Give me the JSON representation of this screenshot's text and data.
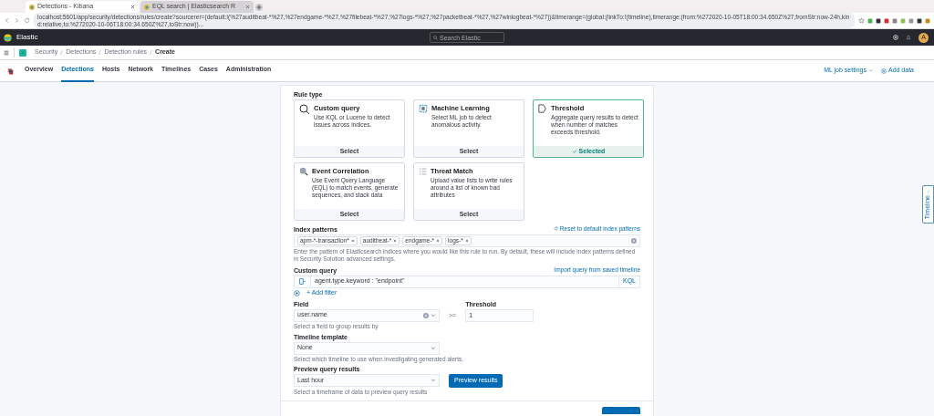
{
  "browser": {
    "tabs": [
      {
        "title": "Detections - Kibana",
        "selected": true
      },
      {
        "title": "EQL search | Elasticsearch R",
        "selected": false
      }
    ],
    "url": "localhost:5601/app/security/detections/rules/create?sourcerer=(default:!(%27auditbeat-*%27,%27endgame-*%27,%27filebeat-*%27,%27logs-*%27,%27packetbeat-*%27,%27winlogbeat-*%27))&timerange=(global:(linkTo:!(timeline),timerange:(from:%272020-10-05T18:00:34.650Z%27,fromStr:now-24h,kind:relative,to:%272020-10-06T18:00:34.650Z%27,toStr:now))..."
  },
  "header": {
    "app_name": "Elastic",
    "search_placeholder": "Search Elastic",
    "avatar": "A"
  },
  "breadcrumbs": [
    "Security",
    "Detections",
    "Detection rules",
    "Create"
  ],
  "nav": {
    "tabs": [
      {
        "label": "Overview",
        "selected": false
      },
      {
        "label": "Detections",
        "selected": true
      },
      {
        "label": "Hosts",
        "selected": false
      },
      {
        "label": "Network",
        "selected": false
      },
      {
        "label": "Timelines",
        "selected": false
      },
      {
        "label": "Cases",
        "selected": false
      },
      {
        "label": "Administration",
        "selected": false
      }
    ],
    "ml_job_settings": "ML job settings",
    "add_data": "Add data"
  },
  "rule_type": {
    "label": "Rule type",
    "cards": [
      {
        "kind": "query",
        "title": "Custom query",
        "description": "Use KQL or Lucene to detect issues across indices.",
        "action": "Select",
        "selected": false
      },
      {
        "kind": "ml",
        "title": "Machine Learning",
        "description": "Select ML job to detect anomalous activity.",
        "action": "Select",
        "selected": false
      },
      {
        "kind": "threshold",
        "title": "Threshold",
        "description": "Aggregate query results to detect when number of matches exceeds threshold.",
        "action": "Selected",
        "selected": true
      },
      {
        "kind": "eql",
        "title": "Event Correlation",
        "description": "Use Event Query Language (EQL) to match events, generate sequences, and stack data",
        "action": "Select",
        "selected": false
      },
      {
        "kind": "threat",
        "title": "Threat Match",
        "description": "Upload value lists to write rules around a list of known bad attributes",
        "action": "Select",
        "selected": false
      }
    ]
  },
  "index_patterns": {
    "label": "Index patterns",
    "reset_link": "Reset to default index patterns",
    "chips": [
      "apm-*-transaction*",
      "auditbeat-*",
      "endgame-*",
      "logs-*"
    ],
    "help": "Enter the pattern of Elasticsearch indices where you would like this rule to run. By default, these will include index patterns defined in Security Solution advanced settings."
  },
  "custom_query": {
    "label": "Custom query",
    "import_link": "Import query from saved timeline",
    "value": "agent.type.keyword : \"endpoint\"",
    "language": "KQL",
    "add_filter": "+ Add filter"
  },
  "field": {
    "label": "Field",
    "value": "user.name",
    "help": "Select a field to group results by",
    "operator": ">="
  },
  "threshold": {
    "label": "Threshold",
    "value": "1"
  },
  "timeline_template": {
    "label": "Timeline template",
    "value": "None",
    "help": "Select which timeline to use when investigating generated alerts."
  },
  "preview": {
    "label": "Preview query results",
    "value": "Last hour",
    "button": "Preview results",
    "help": "Select a timeframe of data to preview query results"
  },
  "flyout": {
    "label": "Timeline"
  }
}
